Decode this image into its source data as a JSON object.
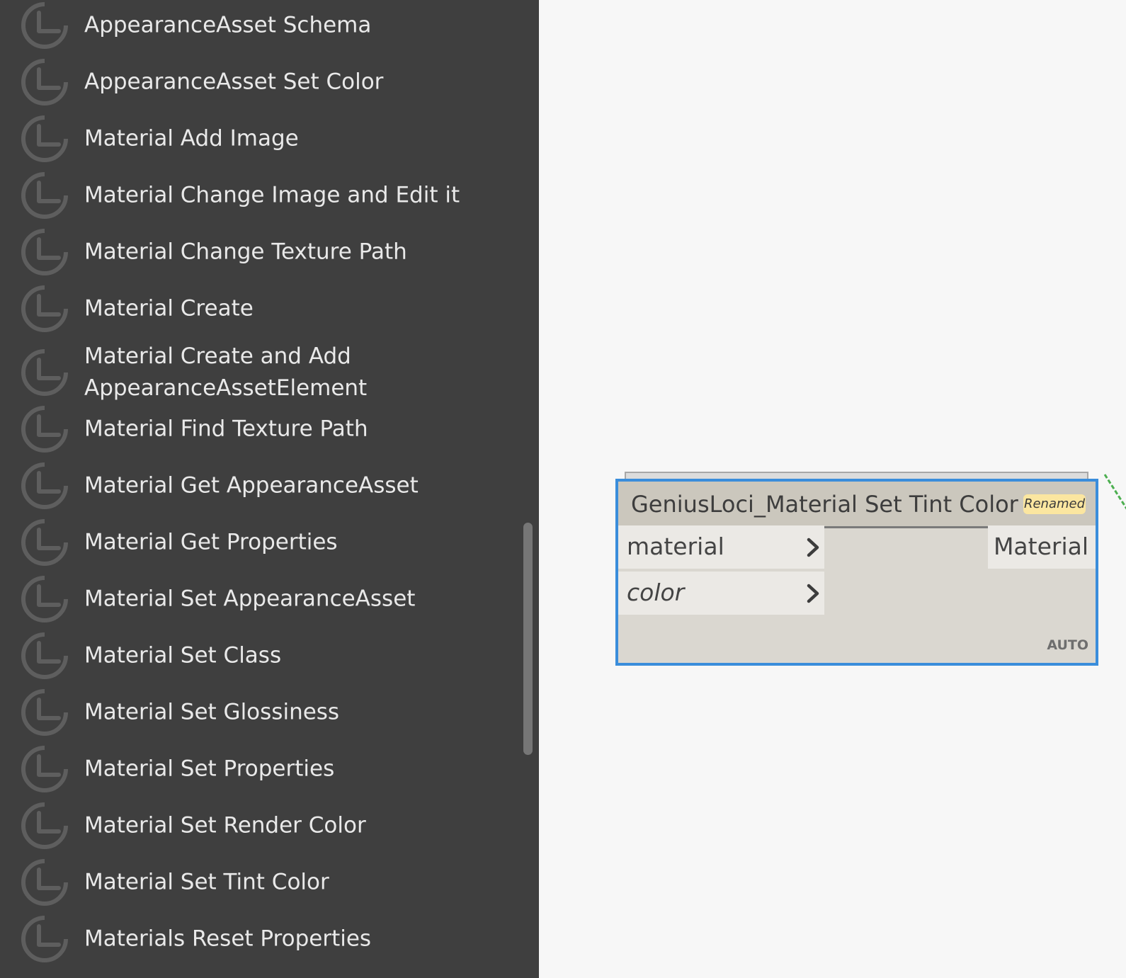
{
  "library": {
    "items": [
      {
        "label": "AppearanceAsset Schema"
      },
      {
        "label": "AppearanceAsset Set Color"
      },
      {
        "label": "Material Add Image"
      },
      {
        "label": "Material Change Image and Edit it"
      },
      {
        "label": "Material Change Texture Path"
      },
      {
        "label": "Material Create"
      },
      {
        "label": "Material Create and Add AppearanceAssetElement"
      },
      {
        "label": "Material Find Texture Path"
      },
      {
        "label": "Material Get AppearanceAsset"
      },
      {
        "label": "Material Get Properties"
      },
      {
        "label": "Material Set AppearanceAsset"
      },
      {
        "label": "Material Set Class"
      },
      {
        "label": "Material Set Glossiness"
      },
      {
        "label": "Material Set Properties"
      },
      {
        "label": "Material Set Render Color"
      },
      {
        "label": "Material Set Tint Color"
      },
      {
        "label": "Materials Reset Properties"
      }
    ],
    "item_icon": "genius-loci-icon"
  },
  "node": {
    "title": "GeniusLoci_Material Set Tint Color",
    "badge": "Renamed",
    "inputs": [
      {
        "label": "material"
      },
      {
        "label": "color"
      }
    ],
    "output": {
      "label": "Material"
    },
    "lacing": "AUTO"
  },
  "colors": {
    "panel_background": "#3f3f3f",
    "canvas_background": "#f7f7f7",
    "node_selected_border": "#3a8ddb",
    "badge_background": "#fbe6a0",
    "wire": "#4caf50"
  }
}
